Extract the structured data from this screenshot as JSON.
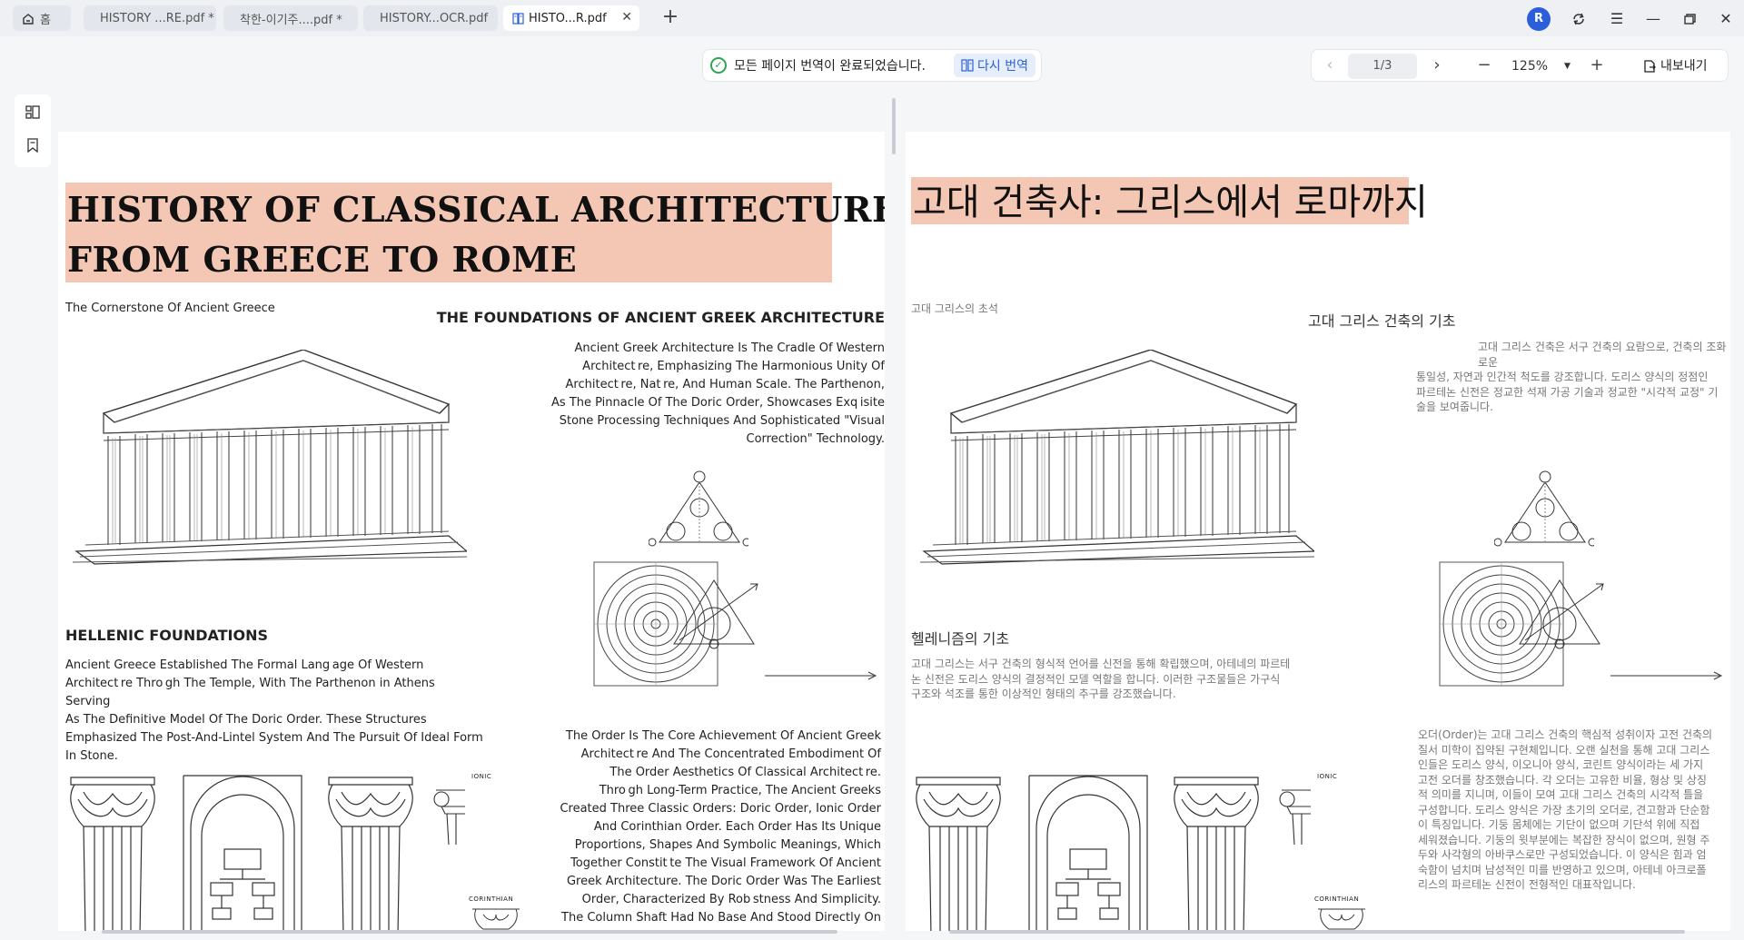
{
  "tabs": [
    {
      "label": "홈",
      "icon": "home-icon"
    },
    {
      "label": "HISTORY ...RE.pdf *"
    },
    {
      "label": "착한-이기주....pdf *"
    },
    {
      "label": "HISTORY...OCR.pdf"
    },
    {
      "label": "HISTO...R.pdf",
      "icon": "translate-doc-icon",
      "active": true
    }
  ],
  "window": {
    "avatar_initial": "R"
  },
  "toolbar": {
    "status_text": "모든 페이지 번역이 완료되었습니다.",
    "retranslate_label": "다시 번역",
    "page_indicator": "1/3",
    "zoom": "125%",
    "export_label": "내보내기"
  },
  "left_page": {
    "title_line1": "HISTORY OF CLASSICAL ARCHITECTURE:",
    "title_line2": "FROM GREECE TO ROME",
    "subtitle": "The Cornerstone Of Ancient Greece",
    "section1_heading": "THE FOUNDATIONS OF ANCIENT GREEK ARCHITECTURE",
    "section1_lines": [
      "Ancient Greek Architecture Is The Cradle Of Western",
      "Architect re, Emphasizing The Harmonious Unity Of",
      "Architect re, Nat re, And Human Scale. The Parthenon,",
      "As The Pinnacle Of The Doric Order, Showcases Exq isite",
      "Stone Processing Techniques And Sophisticated \"Visual",
      "Correction\" Technology."
    ],
    "section2_heading": "HELLENIC FOUNDATIONS",
    "section2_lines": [
      "Ancient Greece Established The Formal Lang age Of Western",
      "Architect re Thro gh The Temple, With The Parthenon in Athens Serving",
      "As The Definitive Model Of The Doric Order. These Structures",
      "Emphasized The Post-And-Lintel System And The Pursuit Of Ideal Form",
      "In Stone."
    ],
    "section3_lines": [
      "The Order Is The Core Achievement Of Ancient Greek",
      "Architect re And The Concentrated Embodiment Of",
      "The Order Aesthetics Of Classical Architect re.",
      "Thro gh Long-Term Practice, The Ancient Greeks",
      "Created Three Classic Orders: Doric Order, Ionic Order",
      "And Corinthian Order. Each Order Has Its Unique",
      "Proportions, Shapes And Symbolic Meanings, Which",
      "Together Constit te The Visual Framework Of Ancient",
      "Greek Architecture. The Doric Order Was The Earliest",
      "Order, Characterized By Rob stness And Simplicity.",
      "The Column Shaft Had No Base And Stood Directly On"
    ],
    "ionic_label": "IONIC",
    "corinthian_label": "CORINTHIAN"
  },
  "right_page": {
    "title": "고대 건축사: 그리스에서 로마까지",
    "subtitle": "고대 그리스의 초석",
    "section1_heading": "고대 그리스 건축의 기초",
    "section1_lines": [
      "고대 그리스 건축은 서구 건축의 요람으로, 건축의 조화로운",
      "통일성, 자연과 인간적 척도를 강조합니다. 도리스 양식의 정점인",
      "파르테논 신전은 정교한 석재 가공 기술과 정교한 \"시각적 교정\" 기",
      "술을 보여줍니다."
    ],
    "section2_heading": "헬레니즘의 기초",
    "section2_lines": [
      "고대 그리스는 서구 건축의 형식적 언어를 신전을 통해 확립했으며, 아테네의 파르테",
      "논 신전은 도리스 양식의 결정적인 모델 역할을 합니다. 이러한 구조물들은 가구식",
      "구조와 석조를 통한 이상적인 형태의 추구를 강조했습니다."
    ],
    "section3_lines": [
      "오더(Order)는 고대 그리스 건축의 핵심적 성취이자 고전 건축의",
      "질서 미학이 집약된 구현체입니다. 오랜 실천을 통해 고대 그리스",
      "인들은 도리스 양식, 이오니아 양식, 코린트 양식이라는 세 가지",
      "고전 오더를 창조했습니다. 각 오더는 고유한 비율, 형상 및 상징",
      "적 의미를 지니며, 이들이 모여 고대 그리스 건축의 시각적 틀을",
      "구성합니다. 도리스 양식은 가장 초기의 오더로, 견고함과 단순함",
      "이 특징입니다. 기둥 몸체에는 기단이 없으며 기단석 위에 직접",
      "세워졌습니다. 기둥의 윗부분에는 복잡한 장식이 없으며, 원형 주",
      "두와 사각형의 아바쿠스로만 구성되었습니다. 이 양식은 힘과 엄",
      "숙함이 넘치며 남성적인 미를 반영하고 있으며, 아테네 아크로폴",
      "리스의 파르테논 신전이 전형적인 대표작입니다."
    ],
    "ionic_label": "IONIC",
    "corinthian_label": "CORINTHIAN"
  },
  "colors": {
    "title_highlight": "#f3c7b3",
    "accent": "#2b5fd9",
    "success": "#2ea44f"
  }
}
